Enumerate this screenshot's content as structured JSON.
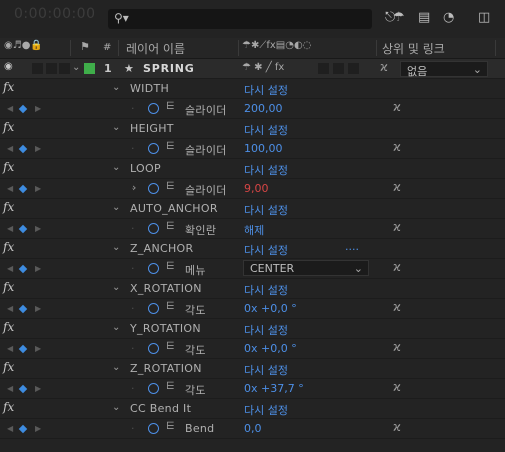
{
  "header_bar": {
    "timecode": "0:00:00:00",
    "search_icon": "search-icon"
  },
  "columns": {
    "hash": "#",
    "layer_name": "레이어 이름",
    "parent_link": "상위 및 링크"
  },
  "layer": {
    "number": "1",
    "name": "SPRING",
    "parent_value": "없음",
    "label_color": "#3fae4a"
  },
  "reset_label": "다시 설정",
  "effects": [
    {
      "fx": "fx",
      "name": "WIDTH",
      "prop": "슬라이더",
      "value": "200,00"
    },
    {
      "fx": "fx",
      "name": "HEIGHT",
      "prop": "슬라이더",
      "value": "100,00"
    },
    {
      "fx": "fx",
      "name": "LOOP",
      "prop": "슬라이더",
      "value": "9,00"
    },
    {
      "fx": "fx",
      "name": "AUTO_ANCHOR",
      "prop": "확인란",
      "value": "해제"
    },
    {
      "fx": "fx",
      "name": "Z_ANCHOR",
      "prop": "메뉴",
      "value": "CENTER",
      "extra": "...."
    },
    {
      "fx": "fx",
      "name": "X_ROTATION",
      "prop": "각도",
      "value": "0x +0,0 °"
    },
    {
      "fx": "fx",
      "name": "Y_ROTATION",
      "prop": "각도",
      "value": "0x +0,0 °"
    },
    {
      "fx": "fx",
      "name": "Z_ROTATION",
      "prop": "각도",
      "value": "0x +37,7 °"
    },
    {
      "fx": "fx",
      "name": "CC Bend It",
      "prop": "Bend",
      "value": "0,0"
    }
  ]
}
